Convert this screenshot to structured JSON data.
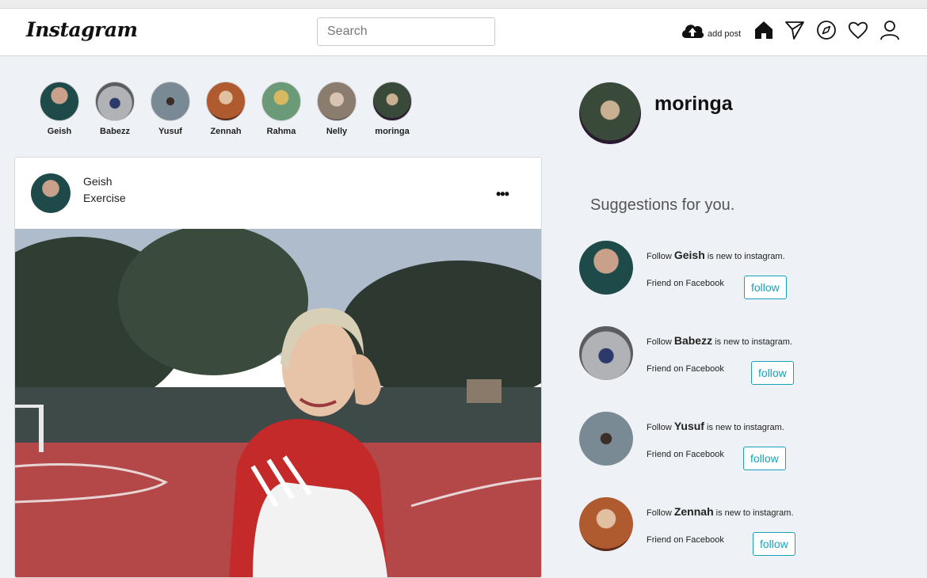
{
  "header": {
    "logo": "Instagram",
    "search_placeholder": "Search",
    "add_post_label": "add post"
  },
  "stories": [
    {
      "name": "Geish",
      "color": "#2a5a5a"
    },
    {
      "name": "Babezz",
      "color": "#8a8c90"
    },
    {
      "name": "Yusuf",
      "color": "#6e7c86"
    },
    {
      "name": "Zennah",
      "color": "#a64a2a"
    },
    {
      "name": "Rahma",
      "color": "#5c8a6a"
    },
    {
      "name": "Nelly",
      "color": "#9a8c7c"
    },
    {
      "name": "moringa",
      "color": "#3a2a4a"
    }
  ],
  "post": {
    "user": "Geish",
    "caption": "Exercise",
    "more": "•••"
  },
  "profile": {
    "username": "moringa"
  },
  "suggestions": {
    "title": "Suggestions for you.",
    "items": [
      {
        "prefix": "Follow ",
        "name": "Geish",
        "suffix": " is new to instagram.",
        "sub": "Friend on Facebook",
        "button": "follow",
        "color": "#24504f"
      },
      {
        "prefix": "Follow ",
        "name": "Babezz",
        "suffix": " is new to instagram.",
        "sub": "Friend on Facebook",
        "button": "follow",
        "color": "#8e9196"
      },
      {
        "prefix": "Follow ",
        "name": "Yusuf",
        "suffix": " is new to instagram.",
        "sub": "Friend on Facebook",
        "button": "follow",
        "color": "#6a7a84"
      },
      {
        "prefix": "Follow ",
        "name": "Zennah",
        "suffix": " is new to instagram.",
        "sub": "Friend on Facebook",
        "button": "follow",
        "color": "#a24a28"
      }
    ]
  },
  "colors": {
    "accent": "#17a2b8",
    "page_bg": "#eef2f6"
  }
}
